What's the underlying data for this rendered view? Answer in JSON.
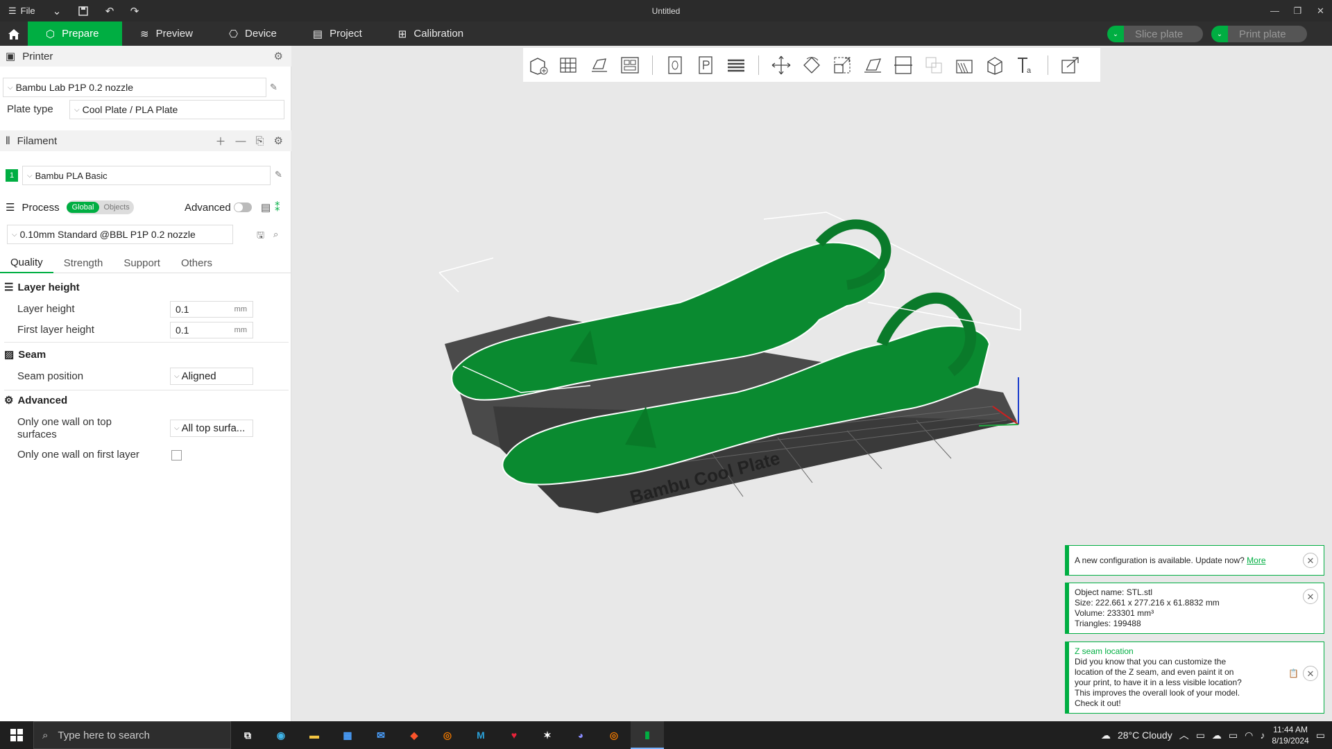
{
  "titlebar": {
    "file_label": "File",
    "title": "Untitled"
  },
  "tabs": [
    {
      "label": "Prepare",
      "icon": "cube-icon",
      "active": true
    },
    {
      "label": "Preview",
      "icon": "layers-icon"
    },
    {
      "label": "Device",
      "icon": "device-icon"
    },
    {
      "label": "Project",
      "icon": "project-icon"
    },
    {
      "label": "Calibration",
      "icon": "calibration-icon"
    }
  ],
  "actions": {
    "slice_label": "Slice plate",
    "print_label": "Print plate"
  },
  "printer": {
    "section_title": "Printer",
    "preset": "Bambu Lab P1P 0.2 nozzle",
    "plate_type_label": "Plate type",
    "plate_type": "Cool Plate / PLA Plate"
  },
  "filament": {
    "section_title": "Filament",
    "slot": "1",
    "slot_color": "#00ae42",
    "preset": "Bambu PLA Basic"
  },
  "process": {
    "section_title": "Process",
    "toggle_global": "Global",
    "toggle_objects": "Objects",
    "advanced_label": "Advanced",
    "preset": "0.10mm Standard @BBL P1P 0.2 nozzle",
    "tabs": [
      "Quality",
      "Strength",
      "Support",
      "Others"
    ],
    "groups": {
      "layer_height": {
        "title": "Layer height",
        "layer_height_label": "Layer height",
        "layer_height_value": "0.1",
        "first_layer_height_label": "First layer height",
        "first_layer_height_value": "0.1",
        "unit": "mm"
      },
      "seam": {
        "title": "Seam",
        "seam_position_label": "Seam position",
        "seam_position_value": "Aligned"
      },
      "advanced": {
        "title": "Advanced",
        "one_wall_top_label_1": "Only one wall on top",
        "one_wall_top_label_2": "surfaces",
        "one_wall_top_value": "All top surfa...",
        "one_wall_first_label": "Only one wall on first layer"
      }
    }
  },
  "viewport": {
    "plate_label": "Bambu Cool Plate",
    "model_color": "#0a8a30"
  },
  "notifications": {
    "config": {
      "text": "A new configuration is available. Update now?",
      "link": "More"
    },
    "object": {
      "line1": "Object name: STL.stl",
      "line2": "Size: 222.661 x 277.216 x 61.8832 mm",
      "line3": "Volume: 233301 mm³",
      "line4": "Triangles: 199488"
    },
    "tip": {
      "title": "Z seam location",
      "line1": "Did you know that you can customize the",
      "line2": "location of the Z seam, and even paint it on",
      "line3": "your print, to have it in a less visible location?",
      "line4": "This improves the overall look of your model.",
      "line5": "Check it out!"
    }
  },
  "taskbar": {
    "search_placeholder": "Type here to search",
    "weather": "28°C  Cloudy",
    "time": "11:44 AM",
    "date": "8/19/2024"
  }
}
